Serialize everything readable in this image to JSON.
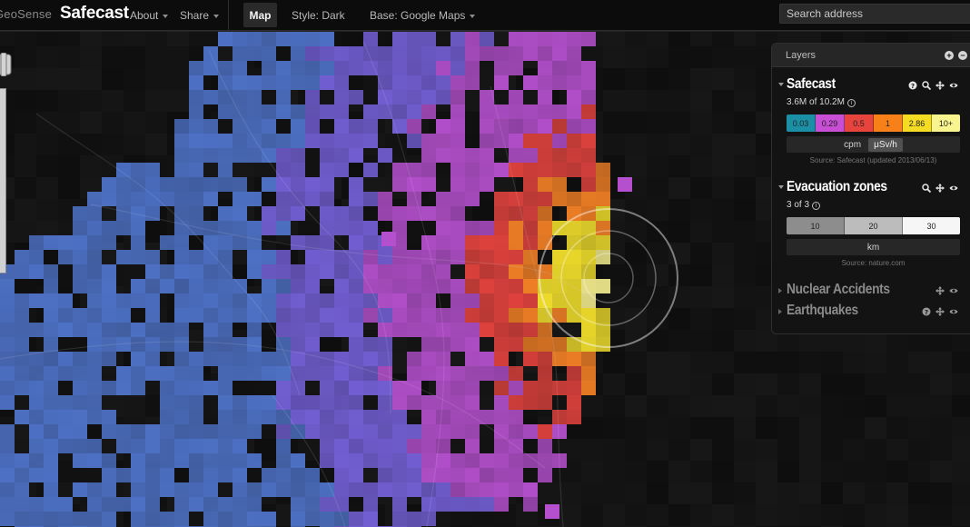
{
  "app": {
    "brand_prefix": "GeoSense",
    "brand_name": "Safecast"
  },
  "menu": {
    "about": "About",
    "share": "Share",
    "map": "Map",
    "style": "Style: Dark",
    "base": "Base: Google Maps"
  },
  "search": {
    "placeholder": "Search address"
  },
  "panel": {
    "title": "Layers",
    "layers": [
      {
        "title": "Safecast",
        "count": "3.6M of 10.2M",
        "legend": [
          {
            "label": "0.03",
            "color": "#1b8fa6"
          },
          {
            "label": "0.29",
            "color": "#c84ed6"
          },
          {
            "label": "0.5",
            "color": "#e8443e"
          },
          {
            "label": "1",
            "color": "#f78019"
          },
          {
            "label": "2.86",
            "color": "#f3dc21"
          },
          {
            "label": "10+",
            "color": "#f8f48e"
          }
        ],
        "units": [
          "cpm",
          "μSv/h"
        ],
        "active_unit": "μSv/h",
        "source": "Source: Safecast (updated 2013/06/13)"
      },
      {
        "title": "Evacuation zones",
        "count": "3 of 3",
        "legend": [
          {
            "label": "10",
            "color": "#8d8d8d"
          },
          {
            "label": "20",
            "color": "#bcbcbc"
          },
          {
            "label": "30",
            "color": "#f6f6f6"
          }
        ],
        "unit": "km",
        "source": "Source: nature.com"
      },
      {
        "title": "Nuclear Accidents"
      },
      {
        "title": "Earthquakes"
      }
    ]
  },
  "colors": {
    "cell_blue": "#4f73c9",
    "cell_violet": "#7460d6",
    "cell_magenta": "#b450cd",
    "cell_red": "#e3433e",
    "cell_orange": "#f38126",
    "cell_yellow": "#f2df2c",
    "cell_pale": "#f5ee90"
  },
  "icons": [
    "help-icon",
    "zoom-icon",
    "move-icon",
    "visibility-icon",
    "add-icon",
    "remove-icon",
    "map-control-icon"
  ]
}
